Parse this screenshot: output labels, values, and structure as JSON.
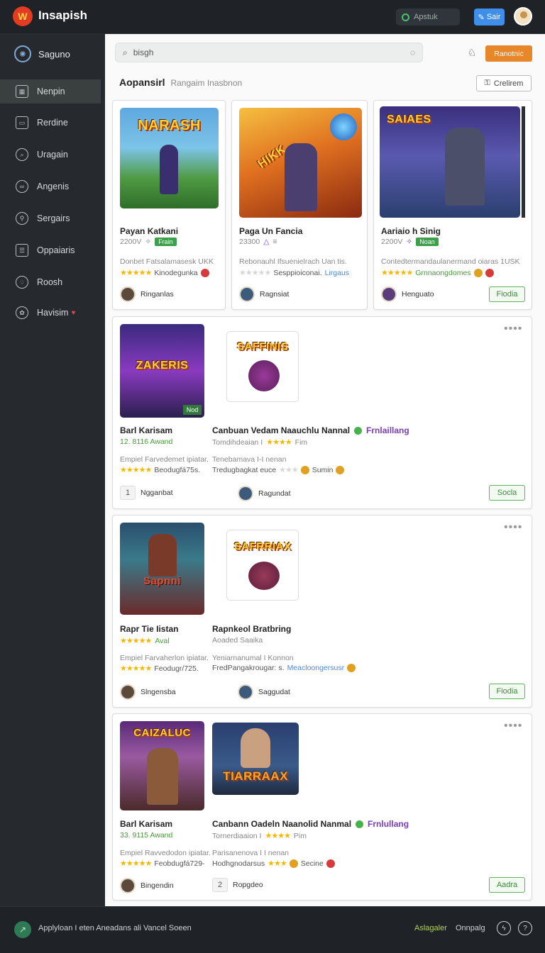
{
  "topbar": {
    "app_name": "Insapish",
    "status_label": "Apstuk",
    "save_label": "Sair"
  },
  "sidebar": {
    "header": "Saguno",
    "items": [
      {
        "label": "Nenpin",
        "icon": "grid-icon",
        "active": true
      },
      {
        "label": "Rerdine",
        "icon": "calendar-icon"
      },
      {
        "label": "Uragain",
        "icon": "search-icon"
      },
      {
        "label": "Angenis",
        "icon": "link-icon"
      },
      {
        "label": "Sergairs",
        "icon": "tools-icon"
      },
      {
        "label": "Oppaiaris",
        "icon": "folder-icon"
      },
      {
        "label": "Roosh",
        "icon": "bell-icon"
      },
      {
        "label": "Havisim",
        "icon": "settings-icon",
        "badge": "♥"
      }
    ]
  },
  "toolbar": {
    "search_value": "bisgh",
    "premium_label": "Ranotnic",
    "create_label": "Crelirem"
  },
  "section": {
    "title": "Aopansirl",
    "subtitle": "Rangaim Inasbnon"
  },
  "top_cards": [
    {
      "title": "Payan Katkani",
      "meta": "2200V",
      "tag": "Frain",
      "thumb_title": "NARASH",
      "desc": "Donbet Fatsalamasesk UKK",
      "rating_text": "Kinodegunka",
      "user": "Ringanlas",
      "accent": "#4a8a3a"
    },
    {
      "title": "Paga Un Fancia",
      "meta": "23300",
      "tag": "",
      "thumb_title": "HIKK",
      "desc": "Rebonauhl Ifsuenielrach Uan tis.",
      "rating_text": "Sesppioiconai.",
      "rating_link": "Lirgaus",
      "user": "Ragnsiat",
      "accent": "#c54a1a"
    },
    {
      "title": "Aariaio h Sinig",
      "meta": "2200V",
      "tag": "Noan",
      "thumb_title": "SAIAES",
      "desc": "Contedtermandaulanermand oiaras 1USK",
      "rating_text": "Grnnaongdomes",
      "user": "Henguato",
      "button": "Fiodia",
      "accent": "#3a4a8a"
    }
  ],
  "list_cards": [
    {
      "left": {
        "title": "Barl Karisam",
        "meta": "12. 8116 Awand",
        "thumb_title": "ZAKERIS",
        "desc": "Empiel Farvedemet ipiatar.",
        "rating_text": "Beodugfá75s.",
        "chip": "1",
        "user": "Ngganbat"
      },
      "right": {
        "title": "Canbuan Vedam Naauchlu Nannal",
        "verify": "Frnlaillang",
        "meta": "Tomdihdeaian I",
        "meta2": "Fim",
        "thumb_title": "SAFFINIS",
        "desc": "Tenebamava I-I nenan",
        "rating_text": "Tredugbagkat euce",
        "rating_extra": "Sumin",
        "user": "Ragundat"
      },
      "button": "Socla"
    },
    {
      "left": {
        "title": "Rapr Tie Iistan",
        "meta": "Aval",
        "thumb_title": "Sapnni",
        "desc": "Empiel Farvaherlon ipiatar.",
        "rating_text": "Feodugr/725.",
        "user": "Slngensba"
      },
      "right": {
        "title": "Rapnkeol Bratbring",
        "meta": "Aoaded Saaika",
        "thumb_title": "SAFRRIAX",
        "desc": "Yeniarnanumal I Konnon",
        "rating_text": "FredPangakrougar: s.",
        "rating_link": "Meacloongersusr",
        "user": "Saggudat"
      },
      "button": "Fiodia"
    },
    {
      "left": {
        "title": "Barl Karisam",
        "meta": "33. 9115 Awand",
        "thumb_title": "CAIZALUC",
        "desc": "Empiel Ravvedodon ipiatar.",
        "rating_text": "Feobdugfá729-",
        "user": "Bingendin"
      },
      "right": {
        "title": "Canbann Oadeln Naanolid Nanmal",
        "verify": "Frnlullang",
        "meta": "Tornerdiaaion I",
        "meta2": "Pim",
        "thumb_title": "TIARRAAX",
        "desc": "Parisanenova I I nenan",
        "rating_text": "Hodhgnodarsus",
        "rating_extra": "Secine",
        "chip": "2",
        "user": "Ropgdeo"
      },
      "button": "Aadra"
    }
  ],
  "footer": {
    "text": "Applyloan I eten Aneadans ali Vancel Soeen",
    "link_green": "Aslagaler",
    "link": "Onnpalg"
  }
}
